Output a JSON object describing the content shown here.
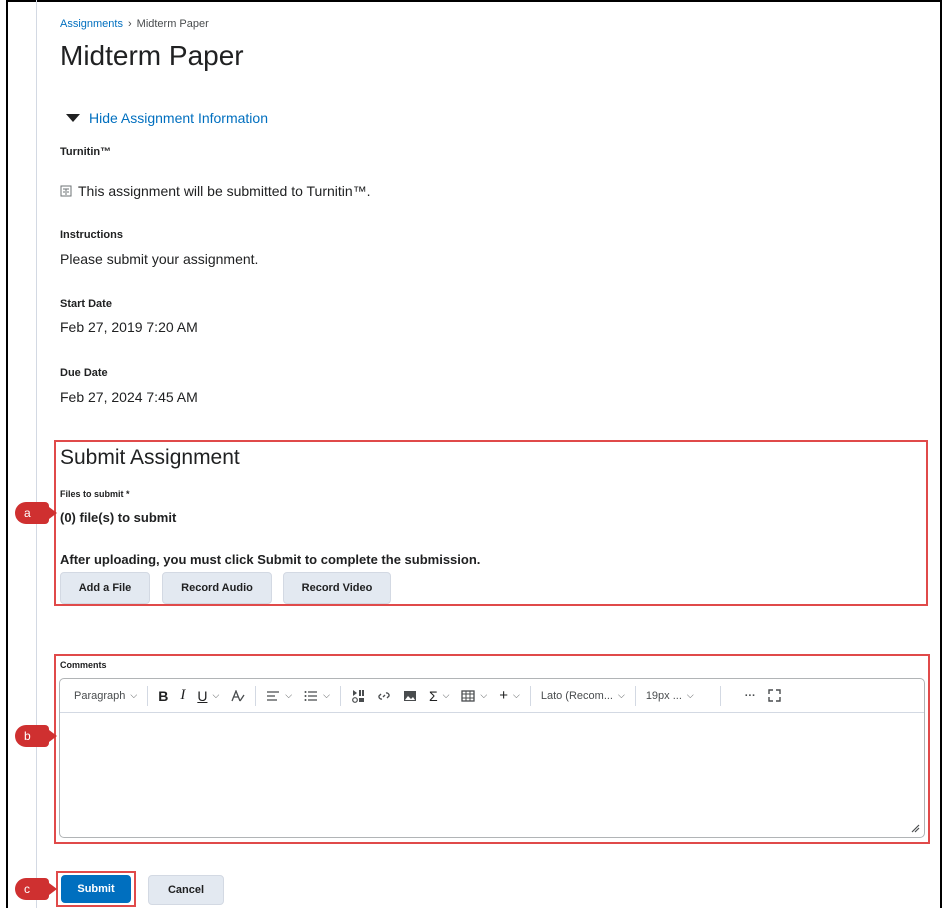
{
  "breadcrumb": {
    "parent": "Assignments",
    "separator": "›",
    "current": "Midterm Paper"
  },
  "page_title": "Midterm Paper",
  "toggle_label": "Hide Assignment Information",
  "turnitin": {
    "label": "Turnitin™",
    "text": "This assignment will be submitted to Turnitin™."
  },
  "instructions": {
    "label": "Instructions",
    "text": "Please submit your assignment."
  },
  "start_date": {
    "label": "Start Date",
    "value": "Feb 27, 2019 7:20 AM"
  },
  "due_date": {
    "label": "Due Date",
    "value": "Feb 27, 2024 7:45 AM"
  },
  "submit_section": {
    "heading": "Submit Assignment",
    "files_label": "Files to submit *",
    "files_count": "(0) file(s) to submit",
    "notice": "After uploading, you must click Submit to complete the submission.",
    "buttons": {
      "add_file": "Add a File",
      "record_audio": "Record Audio",
      "record_video": "Record Video"
    }
  },
  "comments": {
    "label": "Comments",
    "toolbar": {
      "paragraph": "Paragraph",
      "bold": "B",
      "italic": "I",
      "underline": "U",
      "font": "Lato (Recom...",
      "size": "19px ...",
      "more": "···"
    }
  },
  "actions": {
    "submit": "Submit",
    "cancel": "Cancel"
  },
  "markers": {
    "a": "a",
    "b": "b",
    "c": "c"
  },
  "colors": {
    "link": "#006fbf",
    "primary": "#006fbf",
    "highlight": "#e04a4a",
    "marker": "#cf3030"
  }
}
